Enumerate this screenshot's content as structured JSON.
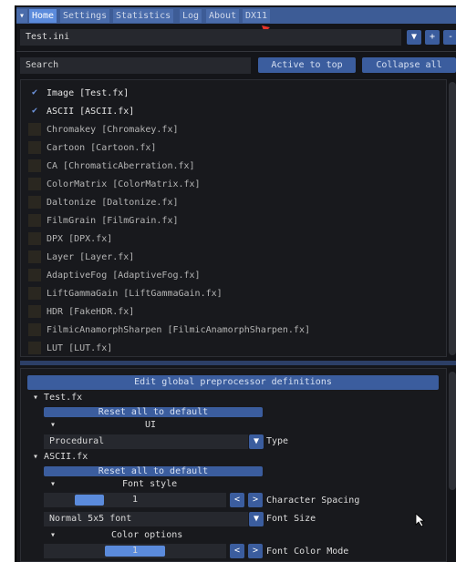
{
  "tabs": [
    {
      "label": "Home",
      "active": true
    },
    {
      "label": "Settings"
    },
    {
      "label": "Statistics"
    },
    {
      "label": "Log"
    },
    {
      "label": "About"
    },
    {
      "label": "DX11"
    }
  ],
  "preset": {
    "value": "Test.ini",
    "dropdown": "▼",
    "add": "+",
    "remove": "-"
  },
  "search": {
    "placeholder": "Search",
    "active_to_top": "Active to top",
    "collapse_all": "Collapse all"
  },
  "effects": [
    {
      "label": "Image [Test.fx]",
      "checked": true
    },
    {
      "label": "ASCII [ASCII.fx]",
      "checked": true
    },
    {
      "label": "Chromakey [Chromakey.fx]",
      "checked": false
    },
    {
      "label": "Cartoon [Cartoon.fx]",
      "checked": false
    },
    {
      "label": "CA [ChromaticAberration.fx]",
      "checked": false
    },
    {
      "label": "ColorMatrix [ColorMatrix.fx]",
      "checked": false
    },
    {
      "label": "Daltonize [Daltonize.fx]",
      "checked": false
    },
    {
      "label": "FilmGrain [FilmGrain.fx]",
      "checked": false
    },
    {
      "label": "DPX [DPX.fx]",
      "checked": false
    },
    {
      "label": "Layer [Layer.fx]",
      "checked": false
    },
    {
      "label": "AdaptiveFog [AdaptiveFog.fx]",
      "checked": false
    },
    {
      "label": "LiftGammaGain [LiftGammaGain.fx]",
      "checked": false
    },
    {
      "label": "HDR [FakeHDR.fx]",
      "checked": false
    },
    {
      "label": "FilmicAnamorphSharpen [FilmicAnamorphSharpen.fx]",
      "checked": false
    },
    {
      "label": "LUT [LUT.fx]",
      "checked": false
    }
  ],
  "params": {
    "edit_global": "Edit global preprocessor definitions",
    "test_fx": "Test.fx",
    "reset1": "Reset all to default",
    "ui_group": "UI",
    "type_value": "Procedural",
    "type_label": "Type",
    "ascii_fx": "ASCII.fx",
    "reset2": "Reset all to default",
    "font_style": "Font style",
    "char_spacing_value": "1",
    "char_spacing_label": "Character Spacing",
    "font_size_value": "Normal 5x5 font",
    "font_size_label": "Font Size",
    "color_options": "Color options",
    "font_color_value": "1",
    "font_color_label": "Font Color Mode",
    "prev": "<",
    "next": ">",
    "arrow": "▼"
  },
  "colors": {
    "accent": "#3b5d9e",
    "active_tab": "#5b8bdc",
    "background": "#141519",
    "annotation_arrow": "#e8332a"
  }
}
